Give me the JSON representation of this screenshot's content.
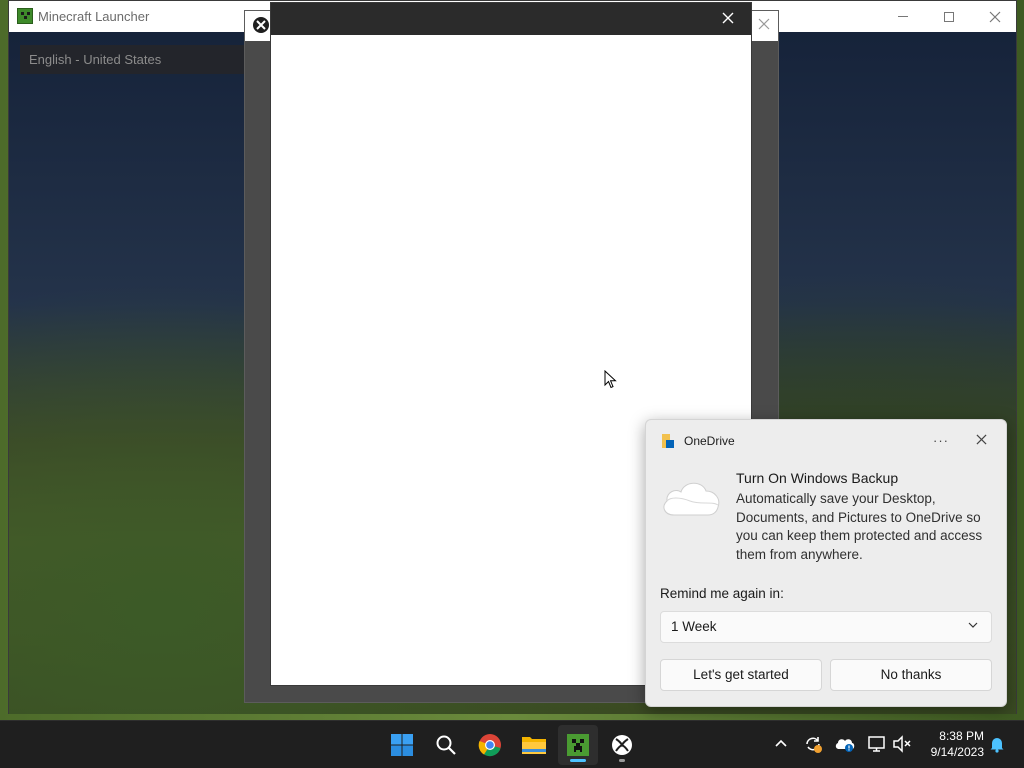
{
  "launcher": {
    "title": "Minecraft Launcher",
    "language": "English - United States"
  },
  "toast": {
    "app_name": "OneDrive",
    "heading": "Turn On Windows Backup",
    "body": "Automatically save your Desktop, Documents, and Pictures to OneDrive so you can keep them protected and access them from anywhere.",
    "remind_label": "Remind me again in:",
    "remind_value": "1 Week",
    "primary_button": "Let's get started",
    "secondary_button": "No thanks"
  },
  "taskbar": {
    "apps": [
      "start-icon",
      "search-icon",
      "chrome-icon",
      "file-explorer-icon",
      "minecraft-icon",
      "xbox-icon"
    ],
    "time": "8:38 PM",
    "date": "9/14/2023"
  },
  "colors": {
    "accent": "#4cc2ff",
    "minecraft_green": "#3e8a2a",
    "onedrive_blue": "#0364b8"
  }
}
